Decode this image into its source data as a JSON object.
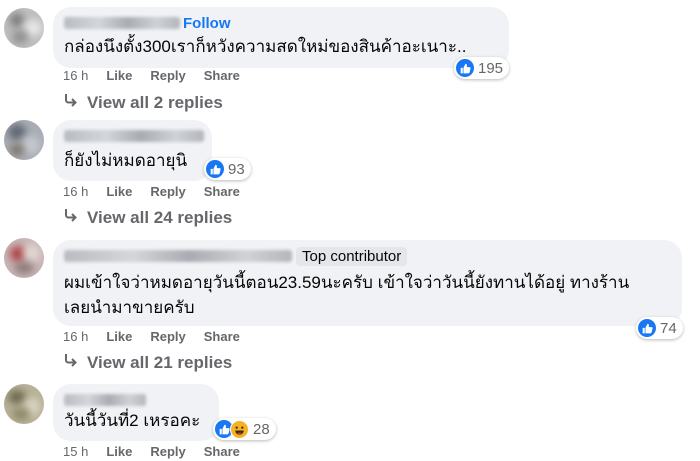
{
  "comments": [
    {
      "follow_label": "Follow",
      "badge": "",
      "text_lines": [
        "กล่องนึงตั้ง300เราก็หวังความสดใหม่ของสินค้าอะเนาะ.."
      ],
      "reaction_count": "195",
      "reactions": [
        "like-icon"
      ],
      "timestamp": "16 h",
      "like_label": "Like",
      "reply_label": "Reply",
      "share_label": "Share",
      "view_replies": "View all 2 replies"
    },
    {
      "follow_label": "",
      "badge": "",
      "text_lines": [
        "ก็ยังไม่หมดอายุนิ"
      ],
      "reaction_count": "93",
      "reactions": [
        "like-icon"
      ],
      "timestamp": "16 h",
      "like_label": "Like",
      "reply_label": "Reply",
      "share_label": "Share",
      "view_replies": "View all 24 replies"
    },
    {
      "follow_label": "",
      "badge": "Top contributor",
      "text_lines": [
        "ผมเข้าใจว่าหมดอายุวันนี้ตอน23.59นะครับ เข้าใจว่าวันนี้ยังทานได้อยู่ ทางร้าน",
        "เลยนำมาขายครับ"
      ],
      "reaction_count": "74",
      "reactions": [
        "like-icon"
      ],
      "timestamp": "16 h",
      "like_label": "Like",
      "reply_label": "Reply",
      "share_label": "Share",
      "view_replies": "View all 21 replies"
    },
    {
      "follow_label": "",
      "badge": "",
      "text_lines": [
        "วันนี้วันที่2 เหรอคะ"
      ],
      "reaction_count": "28",
      "reactions": [
        "like-icon",
        "haha-icon"
      ],
      "timestamp": "15 h",
      "like_label": "Like",
      "reply_label": "Reply",
      "share_label": "Share",
      "view_replies": ""
    }
  ],
  "colors": {
    "bubble": "#f0f2f5",
    "link": "#1877f2",
    "meta": "#65676b",
    "text": "#050505",
    "like": "#1877f2",
    "haha": "#f7b125"
  }
}
